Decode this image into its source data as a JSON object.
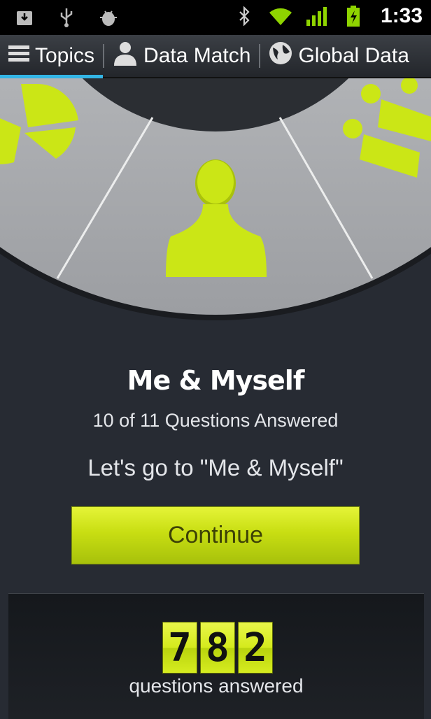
{
  "status_bar": {
    "time": "1:33",
    "icons": [
      "download-icon",
      "usb-icon",
      "android-debug-icon",
      "bluetooth-icon",
      "wifi-icon",
      "signal-icon",
      "battery-charging-icon"
    ]
  },
  "tabs": [
    {
      "label": "Topics",
      "icon": "menu-icon",
      "active": true
    },
    {
      "label": "Data Match",
      "icon": "person-icon",
      "active": false
    },
    {
      "label": "Global Data",
      "icon": "globe-icon",
      "active": false
    }
  ],
  "topic": {
    "title": "Me & Myself",
    "progress": "10 of 11 Questions Answered",
    "prompt": "Let's go to \"Me & Myself\"",
    "continue_label": "Continue"
  },
  "counter": {
    "digits": [
      "7",
      "8",
      "2"
    ],
    "label": "questions answered"
  },
  "colors": {
    "accent": "#c8de12",
    "background": "#272b33",
    "tab_indicator": "#33b5e5"
  }
}
